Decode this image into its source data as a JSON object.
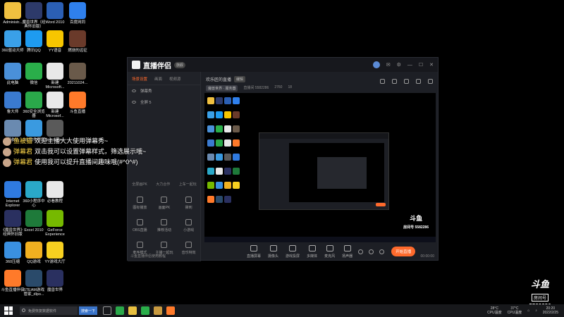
{
  "desktop": {
    "icons": [
      {
        "label": "Administr...",
        "color": "#f0c040"
      },
      {
        "label": "魔兽世界（经\n典怀旧版）",
        "color": "#2d3a6a"
      },
      {
        "label": "Word 2010",
        "color": "#2b5fb4"
      },
      {
        "label": "百度网同",
        "color": "#2f80ed"
      },
      {
        "label": "360驱动大师",
        "color": "#3aa0e8"
      },
      {
        "label": "腾讯QQ",
        "color": "#1e9bf0"
      },
      {
        "label": "YY语音",
        "color": "#f7c600"
      },
      {
        "label": "燃烧的远征",
        "color": "#6a3a2a"
      },
      {
        "label": "此电脑",
        "color": "#4a90d9"
      },
      {
        "label": "微信",
        "color": "#2aae4a"
      },
      {
        "label": "新建\nMicrosoft...",
        "color": "#e8e8e8"
      },
      {
        "label": "20211024...",
        "color": "#6a5a4a"
      },
      {
        "label": "鲁大师",
        "color": "#3a7ad0"
      },
      {
        "label": "360安全浏览\n器",
        "color": "#2aa84a"
      },
      {
        "label": "新建\nMicrosof...",
        "color": "#e8e8e8"
      },
      {
        "label": "斗鱼直播",
        "color": "#ff7a2a"
      },
      {
        "label": "回收站",
        "color": "#6a8ab0"
      },
      {
        "label": "360软件管家",
        "color": "#3a9ae0"
      },
      {
        "label": "Suychann...",
        "color": "#5a5a5a"
      },
      {
        "label": "Internet\nExplorer",
        "color": "#2f7ae0"
      },
      {
        "label": "360小程序中\n心",
        "color": "#2aa8c8"
      },
      {
        "label": "必看教程",
        "color": "#e8e8e8"
      },
      {
        "label": "《魔兽世界》\n经典怀旧版",
        "color": "#2a3060"
      },
      {
        "label": "Excel 2010",
        "color": "#1e7a3a"
      },
      {
        "label": "GeForce\nExperience",
        "color": "#76b900"
      },
      {
        "label": "360压缩",
        "color": "#3a90e0"
      },
      {
        "label": "QQ游戏",
        "color": "#f0b020"
      },
      {
        "label": "YY游戏大厅",
        "color": "#f7d020"
      },
      {
        "label": "斗鱼直播伴侣",
        "color": "#ff7a2a"
      },
      {
        "label": "STEAM游戏\n管家_dlpo...",
        "color": "#2a4a6a"
      },
      {
        "label": "魔兽世界",
        "color": "#2a3060"
      }
    ]
  },
  "app": {
    "title": "直播伴侣",
    "version_badge": "旗舰",
    "left_tabs": [
      "场景设置",
      "画面",
      "视频源"
    ],
    "scenes": [
      "弹幕秀",
      "全屏 5"
    ],
    "grid_labels": [
      "图标播放",
      "画面PK",
      "撕刺",
      "OBS直播",
      "推荐活动",
      "小游戏",
      "麦序模式",
      "主播一起玩",
      "音乐特效"
    ],
    "grid_top": [
      "全屏画PK",
      "大力合作",
      "上车一起玩"
    ],
    "left_footer": "斗鱼直播伴侣使用教程",
    "room_title": "欢乐匠的直播",
    "room_tag": "编辑",
    "room_category": "魔兽世界 · 服务器",
    "room_id": "直播间 5582286",
    "followers": "2760",
    "viewers": "18",
    "bottom_items": [
      "直播屏幕",
      "摄像头",
      "游戏投屏",
      "多媒体",
      "麦克风",
      "扬声器"
    ],
    "start_live": "开始直播",
    "live_time": "00:00:00"
  },
  "chat": [
    {
      "name": "鱼被猫",
      "message": "欢迎主播大大使用弹幕秀~"
    },
    {
      "name": "弹幕君",
      "message": "双击我可以设置弹幕样式，筛选展示哦~"
    },
    {
      "name": "弹幕君",
      "message": "使用我可以提升直播间趣味哦(#^0^#)"
    }
  ],
  "watermark": {
    "brand": "斗鱼",
    "room_label": "房间号",
    "room_number": "5582286"
  },
  "taskbar": {
    "search_placeholder": "免费恢复数据软件",
    "next_button": "搜索一下",
    "temp1": "28°C\nCPU温度",
    "temp2": "37°C\nCPU温度",
    "time": "20:20",
    "date": "2022/2/25"
  }
}
